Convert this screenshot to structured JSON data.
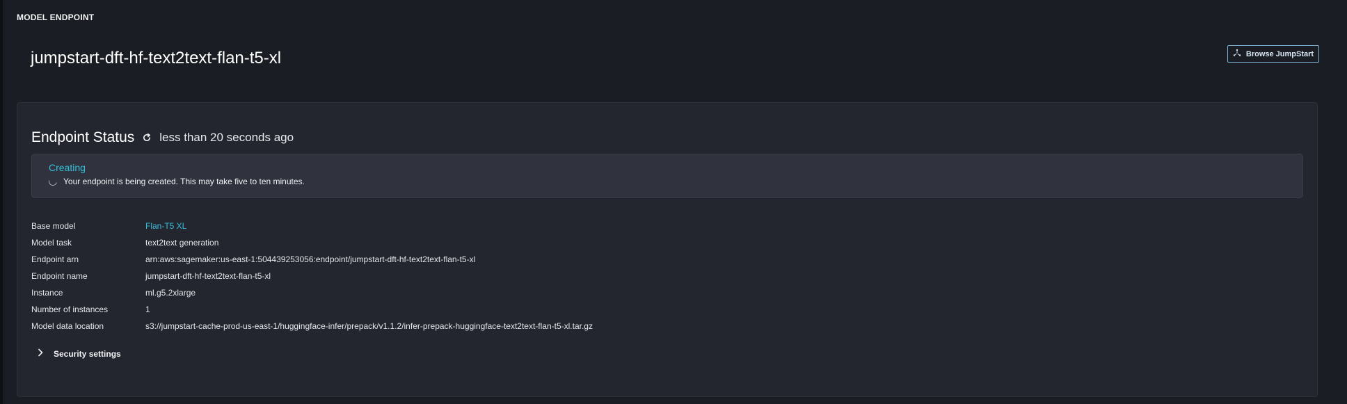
{
  "header": {
    "section_label": "MODEL ENDPOINT",
    "title": "jumpstart-dft-hf-text2text-flan-t5-xl",
    "browse_button": {
      "label": "Browse JumpStart",
      "icon": "jumpstart-icon"
    }
  },
  "status": {
    "title": "Endpoint Status",
    "refresh_icon": "refresh-icon",
    "last_updated": "less than 20 seconds ago",
    "alert": {
      "state": "Creating",
      "message": "Your endpoint is being created. This may take five to ten minutes.",
      "icon": "spinner-icon"
    }
  },
  "details": [
    {
      "key": "Base model",
      "value": "Flan-T5 XL",
      "link": true
    },
    {
      "key": "Model task",
      "value": "text2text generation",
      "link": false
    },
    {
      "key": "Endpoint arn",
      "value": "arn:aws:sagemaker:us-east-1:504439253056:endpoint/jumpstart-dft-hf-text2text-flan-t5-xl",
      "link": false
    },
    {
      "key": "Endpoint name",
      "value": "jumpstart-dft-hf-text2text-flan-t5-xl",
      "link": false
    },
    {
      "key": "Instance",
      "value": "ml.g5.2xlarge",
      "link": false
    },
    {
      "key": "Number of instances",
      "value": "1",
      "link": false
    },
    {
      "key": "Model data location",
      "value": "s3://jumpstart-cache-prod-us-east-1/huggingface-infer/prepack/v1.1.2/infer-prepack-huggingface-text2text-flan-t5-xl.tar.gz",
      "link": false
    }
  ],
  "security": {
    "label": "Security settings",
    "icon": "chevron-right-icon",
    "expanded": false
  },
  "colors": {
    "background": "#1b1d24",
    "card": "#24262f",
    "alert_bg": "#30333d",
    "accent_link": "#34c0dc",
    "button_border": "#7fb3d5"
  }
}
